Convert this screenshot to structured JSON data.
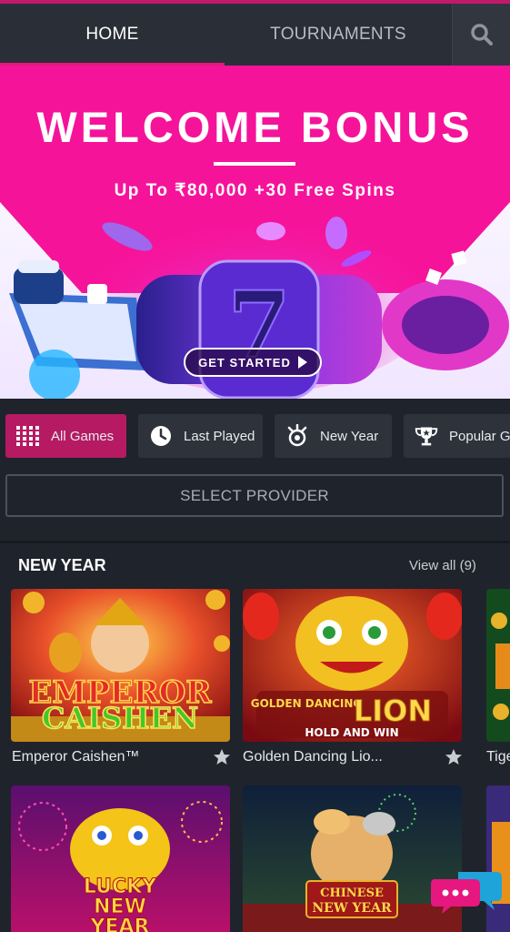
{
  "nav": {
    "home_label": "HOME",
    "tournaments_label": "TOURNAMENTS",
    "search_icon": "search-icon"
  },
  "banner": {
    "title": "WELCOME BONUS",
    "subtitle": "Up To ₹80,000 +30 Free Spins",
    "cta_label": "GET STARTED",
    "reel_symbol": "7"
  },
  "filters": [
    {
      "label": "All Games",
      "icon": "grid-icon",
      "active": true
    },
    {
      "label": "Last Played",
      "icon": "clock-icon",
      "active": false
    },
    {
      "label": "New Year",
      "icon": "firework-icon",
      "active": false
    },
    {
      "label": "Popular G",
      "icon": "trophy-icon",
      "active": false
    }
  ],
  "provider": {
    "label": "SELECT PROVIDER"
  },
  "section": {
    "title": "NEW YEAR",
    "view_all": "View all  (9)"
  },
  "games": [
    {
      "name": "Emperor Caishen™",
      "art_text_1": "EMPEROR",
      "art_text_2": "CAISHEN"
    },
    {
      "name": "Golden Dancing Lio...",
      "art_text_1": "GOLDEN DANCING",
      "art_text_2": "LION",
      "art_text_3": "HOLD AND WIN"
    },
    {
      "name": "Tige"
    },
    {
      "name": "",
      "art_text_1": "LUCKY",
      "art_text_2": "NEW",
      "art_text_3": "YEAR"
    },
    {
      "name": "",
      "art_text_1": "CHINESE",
      "art_text_2": "NEW YEAR"
    },
    {
      "name": ""
    }
  ],
  "colors": {
    "accent_pink": "#e01a7a",
    "chip_active": "#b51a63",
    "background": "#1f232b",
    "banner_pink": "#f5139a"
  }
}
